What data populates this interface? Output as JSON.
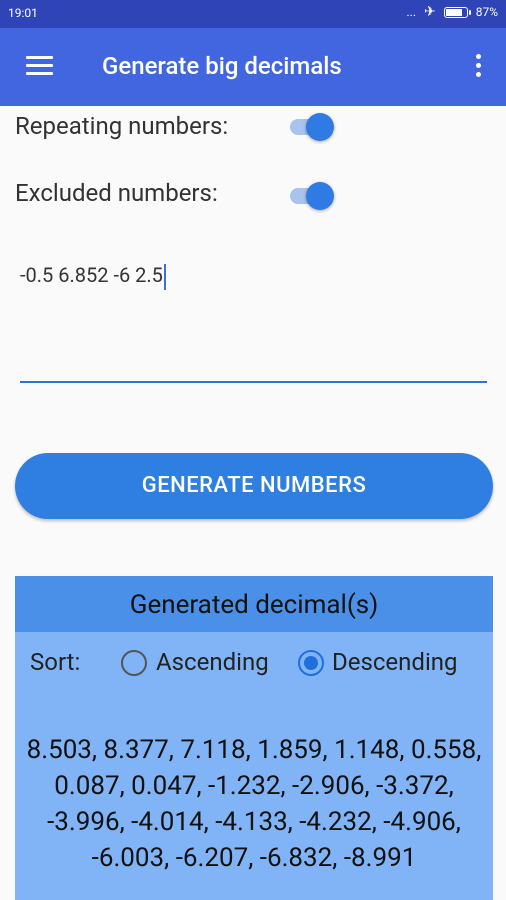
{
  "status_bar": {
    "time": "19:01",
    "dots": "...",
    "battery": "87%",
    "battery_level": 0.87
  },
  "app_bar": {
    "title": "Generate big decimals"
  },
  "options": {
    "repeating_label": "Repeating numbers:",
    "repeating_on": true,
    "excluded_label": "Excluded numbers:",
    "excluded_on": true
  },
  "excluded_input": {
    "value": "-0.5 6.852 -6 2.5"
  },
  "generate_button": {
    "label": "GENERATE NUMBERS"
  },
  "results": {
    "header": "Generated decimal(s)",
    "sort_label": "Sort:",
    "sort_options": [
      {
        "label": "Ascending",
        "selected": false
      },
      {
        "label": "Descending",
        "selected": true
      }
    ],
    "numbers_text": "8.503, 8.377, 7.118, 1.859, 1.148, 0.558, 0.087, 0.047, -1.232, -2.906, -3.372, -3.996, -4.014, -4.133, -4.232, -4.906, -6.003, -6.207, -6.832, -8.991"
  },
  "colors": {
    "status_bar": "#2f45b7",
    "app_bar": "#4166e0",
    "accent": "#2e7fe1",
    "panel": "#80b4f6",
    "panel_header": "#4a90e8"
  }
}
